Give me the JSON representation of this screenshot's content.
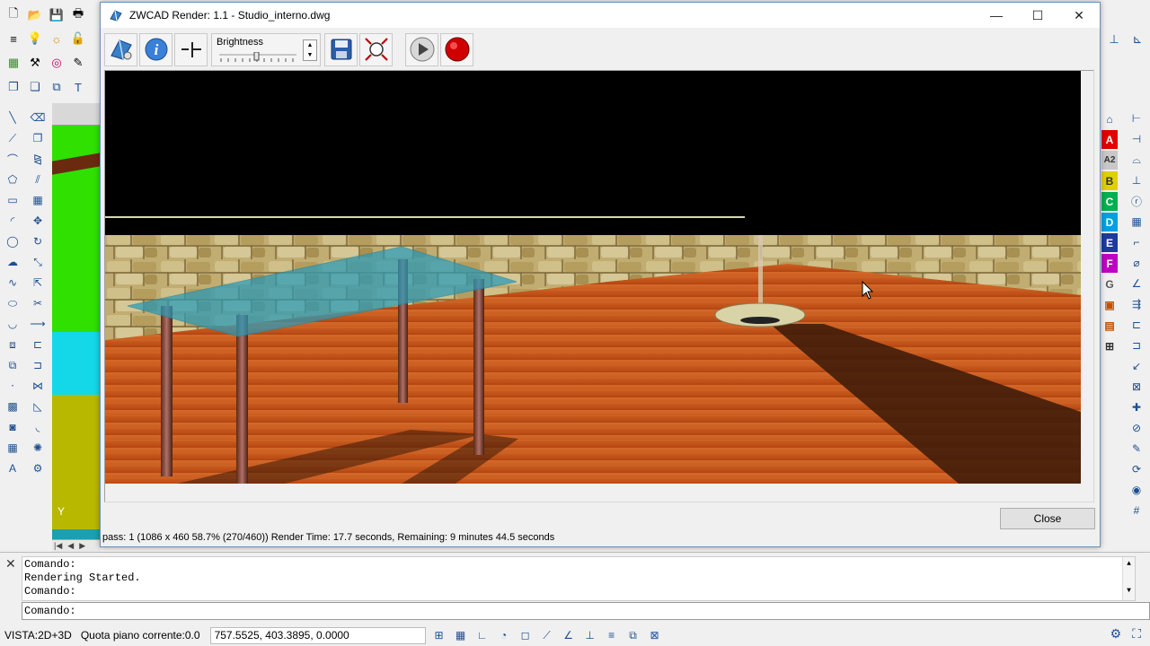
{
  "window": {
    "title": "ZWCAD Render: 1.1 - Studio_interno.dwg",
    "minimize_glyph": "—",
    "maximize_glyph": "☐",
    "close_glyph": "✕"
  },
  "toolbar": {
    "brightness_label": "Brightness",
    "spin_up": "▲",
    "spin_down": "▼"
  },
  "render": {
    "progress_percent": 58.7,
    "rows_done": 270,
    "rows_total": 460,
    "status_text": "pass: 1 (1086 x 460 58.7% (270/460))  Render Time: 17.7 seconds, Remaining: 9 minutes 44.5 seconds"
  },
  "close_button": {
    "label": "Close"
  },
  "command": {
    "lines": [
      "Comando:",
      "Rendering Started.",
      "Comando:"
    ],
    "prompt": "Comando:",
    "close_glyph": "✕"
  },
  "statusbar": {
    "view": "VISTA:2D+3D",
    "elevation": "Quota piano corrente:0.0",
    "coordinates": "757.5525, 403.3895, 0.0000"
  },
  "viewport": {
    "ucs_label": "Y"
  },
  "styles": {
    "letters": [
      "A",
      "A2",
      "B",
      "C",
      "D",
      "E",
      "F",
      "G"
    ],
    "colors": [
      "#e00000",
      "#8a8a8a",
      "#e0d000",
      "#00b050",
      "#00a0e0",
      "#1e3a9a",
      "#c000c0",
      "#8a8a8a"
    ]
  },
  "colors": {
    "floor": "#c8561c",
    "wall": "#b8a56a",
    "glass": "#2a9bb8",
    "title_bg": "#ffffff",
    "window_border": "#6d8fb8"
  }
}
